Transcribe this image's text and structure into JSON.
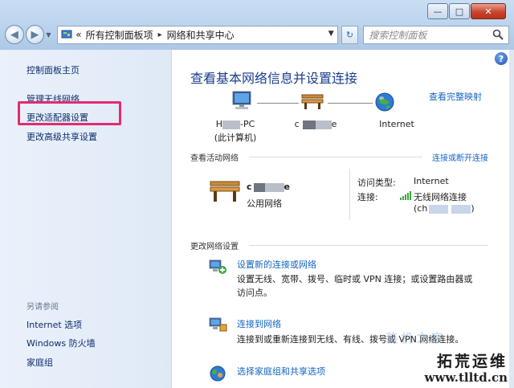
{
  "window": {
    "minimize_label": "—",
    "maximize_label": "□",
    "close_label": "✕"
  },
  "address": {
    "chevrons": "«",
    "crumb1": "所有控制面板项",
    "crumb2": "网络和共享中心",
    "separator": "▸"
  },
  "search": {
    "placeholder": "搜索控制面板"
  },
  "sidebar": {
    "home": "控制面板主页",
    "items": [
      "管理无线网络",
      "更改适配器设置",
      "更改高级共享设置"
    ],
    "see_also_header": "另请参阅",
    "see_also": [
      "Internet 选项",
      "Windows 防火墙",
      "家庭组"
    ]
  },
  "main": {
    "help_label": "?",
    "title": "查看基本网络信息并设置连接",
    "full_map": "查看完整映射",
    "nodes": {
      "pc_name_prefix": "H",
      "pc_name_suffix": "-PC",
      "pc_sub": "(此计算机)",
      "router_prefix": "c",
      "router_suffix": "e",
      "internet": "Internet"
    },
    "active_header": "查看活动网络",
    "connect_disconnect": "连接或断开连接",
    "active": {
      "name_prefix": "c",
      "name_suffix": "e",
      "type": "公用网络",
      "access_type_label": "访问类型:",
      "access_type_value": "Internet",
      "connection_label": "连接:",
      "connection_value": "无线网络连接",
      "ssid_prefix": "(ch",
      "ssid_suffix": ")"
    },
    "change_header": "更改网络设置",
    "tasks": [
      {
        "title": "设置新的连接或网络",
        "desc": "设置无线、宽带、拨号、临时或 VPN 连接；或设置路由器或访问点。"
      },
      {
        "title": "连接到网络",
        "desc": "连接到或重新连接到无线、有线、拨号或 VPN 网络连接。"
      },
      {
        "title": "选择家庭组和共享选项",
        "desc": ""
      }
    ]
  },
  "watermark": {
    "line1": "拓荒运维",
    "line2": "www.tlltd.cn",
    "faint": "装机之家"
  },
  "colors": {
    "link": "#1565c0",
    "title": "#1a3f8c",
    "highlight": "#e62a6f"
  }
}
